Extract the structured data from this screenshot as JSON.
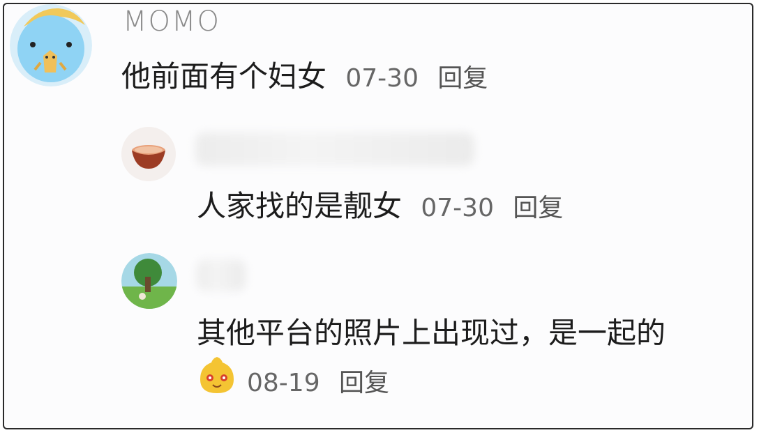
{
  "comments": [
    {
      "username": "MOMO",
      "text": "他前面有个妇女",
      "date": "07-30",
      "reply_label": "回复"
    },
    {
      "text": "人家找的是靓女",
      "date": "07-30",
      "reply_label": "回复"
    },
    {
      "text": "其他平台的照片上出现过，是一起的",
      "date": "08-19",
      "reply_label": "回复"
    }
  ],
  "colors": {
    "border": "#2a2a2a",
    "username": "#8a8a8a",
    "text": "#1c1c1c",
    "meta": "#666666"
  },
  "icons": [
    "cartoon-dinosaur-avatar",
    "tea-bowl-avatar",
    "tree-landscape-avatar",
    "yellow-smiley-emoji"
  ]
}
